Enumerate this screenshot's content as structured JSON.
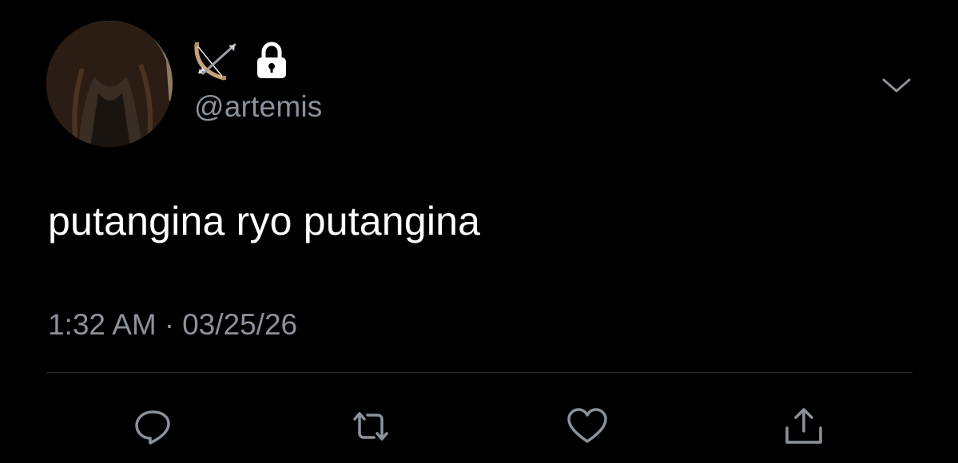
{
  "tweet": {
    "handle": "@artemis",
    "display_name_icons": [
      "bow-and-arrow-icon",
      "lock-icon"
    ],
    "text": "putangina ryo putangina",
    "time": "1:32 AM",
    "separator": "·",
    "date": "03/25/26"
  },
  "actions": [
    "reply-icon",
    "retweet-icon",
    "like-icon",
    "share-icon"
  ],
  "colors": {
    "background": "#000000",
    "text": "#ffffff",
    "secondary_text": "#8b9299",
    "divider": "#2f3336"
  }
}
